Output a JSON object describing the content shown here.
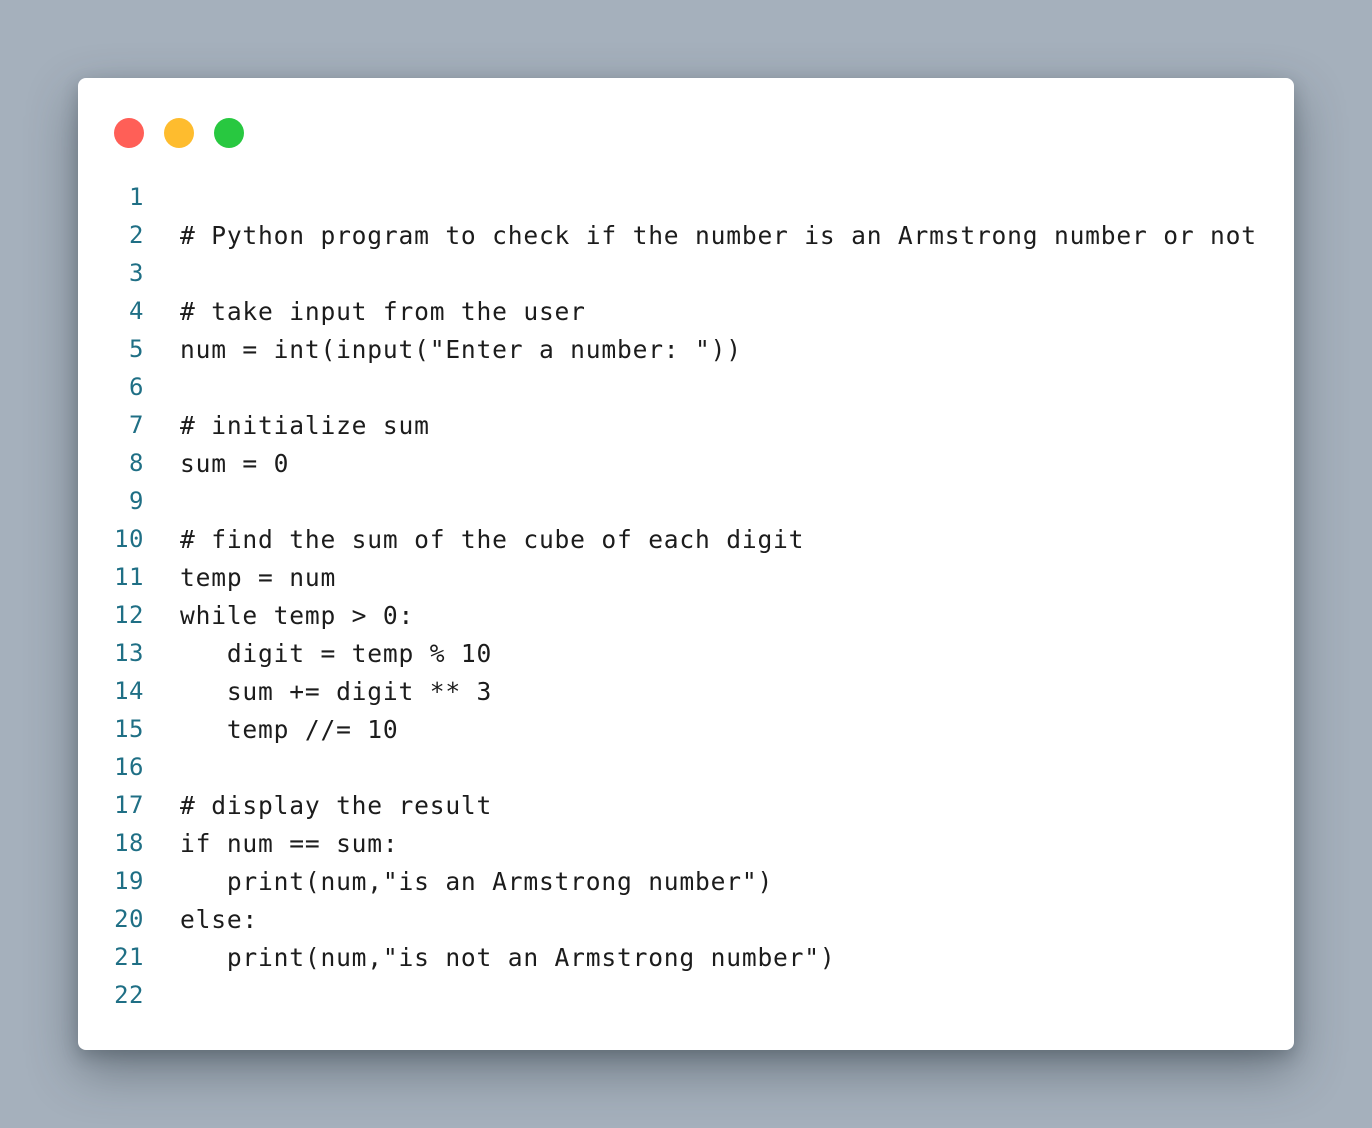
{
  "window": {
    "controls": {
      "close": "close-dot",
      "minimize": "minimize-dot",
      "maximize": "maximize-dot"
    },
    "colors": {
      "close": "#ff5f57",
      "minimize": "#febc2e",
      "maximize": "#28c840",
      "line_number": "#1f6f85",
      "background": "#a5b0bc"
    }
  },
  "code": {
    "lines": [
      {
        "n": "1",
        "text": ""
      },
      {
        "n": "2",
        "text": "# Python program to check if the number is an Armstrong number or not"
      },
      {
        "n": "3",
        "text": ""
      },
      {
        "n": "4",
        "text": "# take input from the user"
      },
      {
        "n": "5",
        "text": "num = int(input(\"Enter a number: \"))"
      },
      {
        "n": "6",
        "text": ""
      },
      {
        "n": "7",
        "text": "# initialize sum"
      },
      {
        "n": "8",
        "text": "sum = 0"
      },
      {
        "n": "9",
        "text": ""
      },
      {
        "n": "10",
        "text": "# find the sum of the cube of each digit"
      },
      {
        "n": "11",
        "text": "temp = num"
      },
      {
        "n": "12",
        "text": "while temp > 0:"
      },
      {
        "n": "13",
        "text": "   digit = temp % 10"
      },
      {
        "n": "14",
        "text": "   sum += digit ** 3"
      },
      {
        "n": "15",
        "text": "   temp //= 10"
      },
      {
        "n": "16",
        "text": ""
      },
      {
        "n": "17",
        "text": "# display the result"
      },
      {
        "n": "18",
        "text": "if num == sum:"
      },
      {
        "n": "19",
        "text": "   print(num,\"is an Armstrong number\")"
      },
      {
        "n": "20",
        "text": "else:"
      },
      {
        "n": "21",
        "text": "   print(num,\"is not an Armstrong number\")"
      },
      {
        "n": "22",
        "text": ""
      }
    ]
  }
}
